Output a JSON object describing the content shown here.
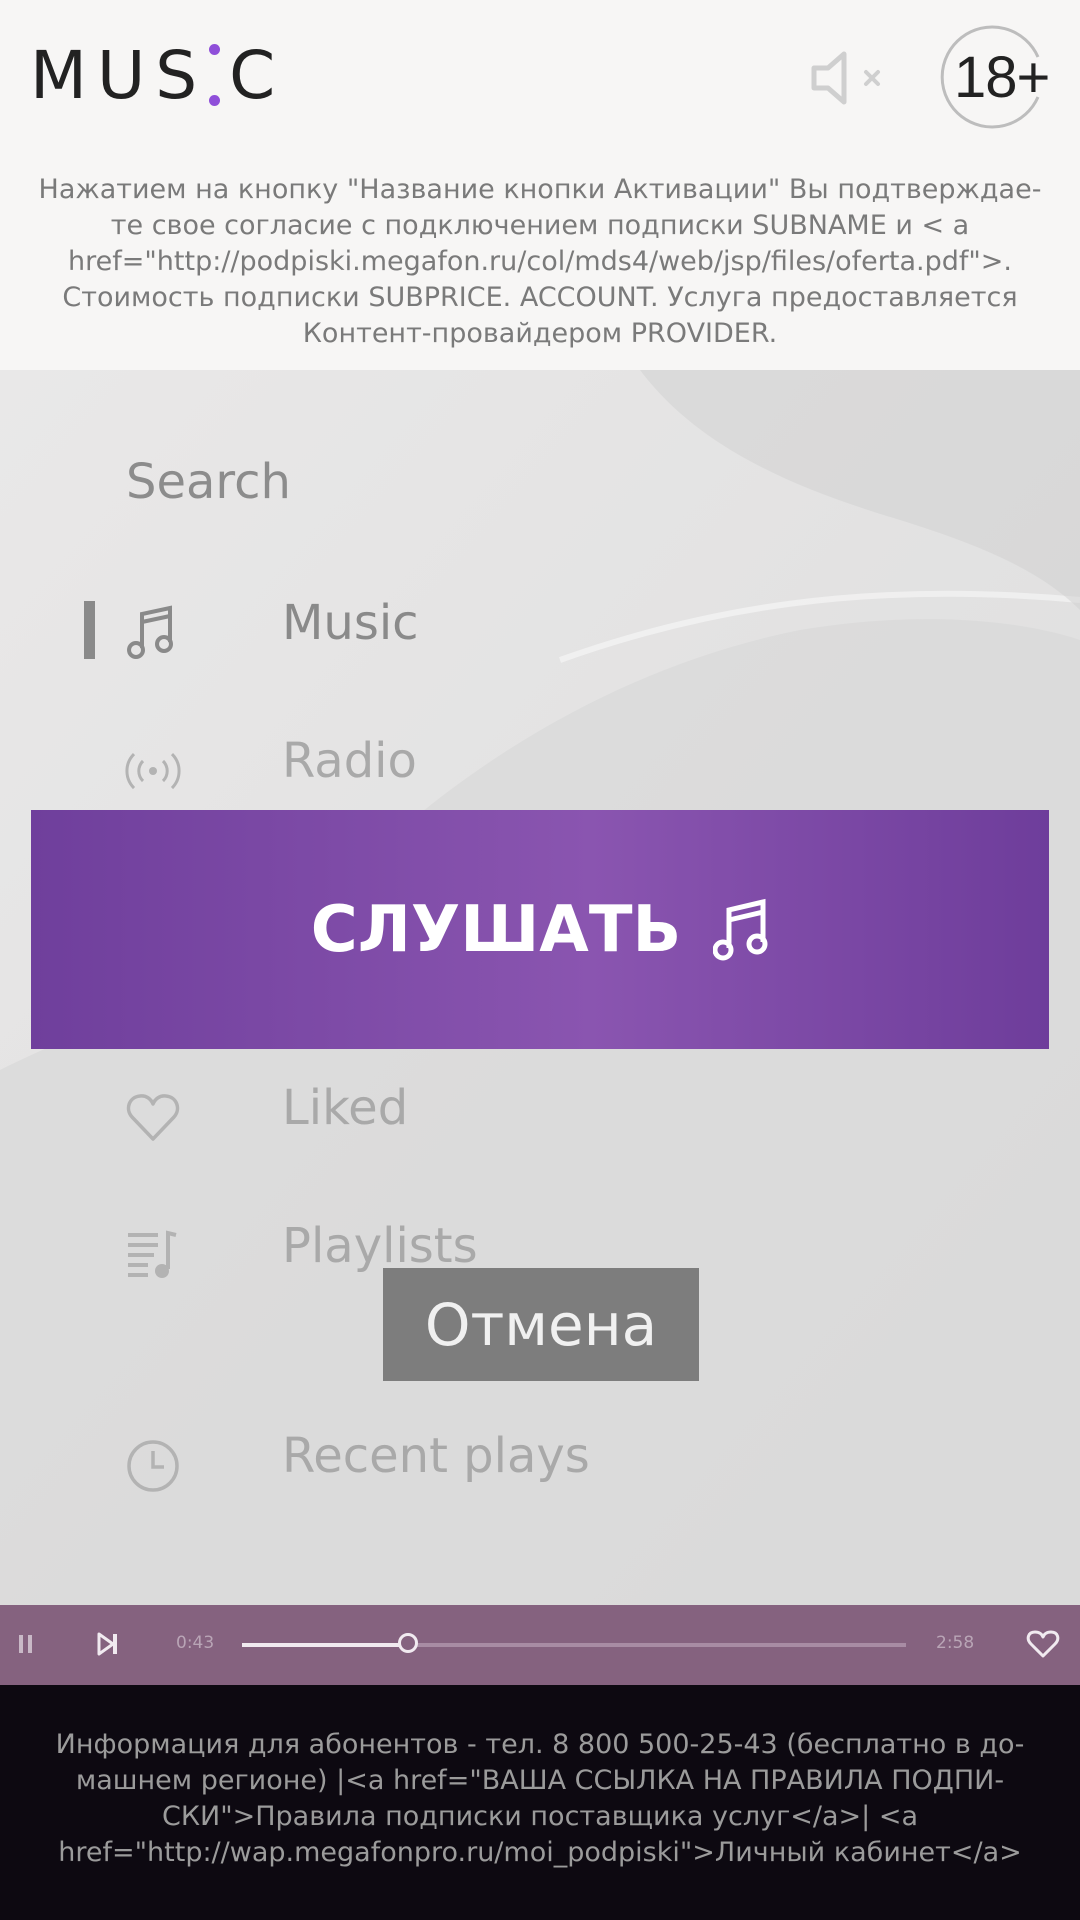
{
  "header": {
    "logo_text_left": "MUS",
    "logo_text_right": "C",
    "age_rating": "18+",
    "mute_icon": "speaker-muted-icon",
    "disclaimer": "Нажатием на кнопку \"Название кнопки Активации\" Вы подтверждае-те свое согласие с подключением подписки SUBNAME и < a href=\"http://podpiski.megafon.ru/col/mds4/web/jsp/files/oferta.pdf\">. Стоимость подписки SUBPRICE. ACCOUNT. Услуга предоставляется Контент-провайдером PROVIDER."
  },
  "menu": {
    "search_label": "Search",
    "items": [
      {
        "label": "Music",
        "icon": "music-note-icon",
        "active": true
      },
      {
        "label": "Radio",
        "icon": "radio-broadcast-icon",
        "active": false
      },
      {
        "label": "Liked",
        "icon": "heart-icon",
        "active": false
      },
      {
        "label": "Playlists",
        "icon": "playlist-icon",
        "active": false
      },
      {
        "label": "Recent plays",
        "icon": "clock-icon",
        "active": false
      }
    ]
  },
  "cta": {
    "listen_label": "СЛУШАТЬ",
    "listen_icon": "music-note-icon",
    "cancel_label": "Отмена",
    "accent_color": "#7c4aa6"
  },
  "player": {
    "elapsed": "0:43",
    "duration": "2:58",
    "progress": 0.25,
    "controls": [
      "pause-icon",
      "next-track-icon",
      "heart-icon"
    ],
    "bar_color": "#85627f"
  },
  "footer": {
    "text": "Информация для абонентов - тел. 8 800 500-25-43 (бесплатно в до-машнем регионе) |<a href=\"ВАША ССЫЛКА НА ПРАВИЛА ПОДПИ-СКИ\">Правила подписки поставщика услуг</a>| <a href=\"http://wap.megafonpro.ru/moi_podpiski\">Личный кабинет</a>"
  }
}
